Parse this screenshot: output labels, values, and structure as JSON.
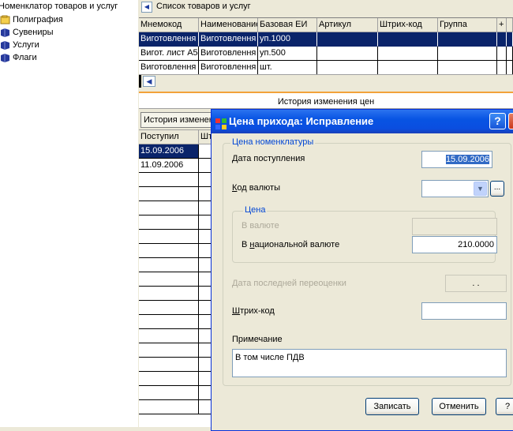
{
  "tree": {
    "root_label": "Номенклатор товаров и услуг",
    "items": [
      {
        "label": "Полиграфия",
        "color": "#d9a21b"
      },
      {
        "label": "Сувениры",
        "color": "#26399b"
      },
      {
        "label": "Услуги",
        "color": "#26399b"
      },
      {
        "label": "Флаги",
        "color": "#26399b"
      }
    ]
  },
  "product_list": {
    "title": "Список товаров и услуг",
    "columns": [
      "Мнемокод",
      "Наименование",
      "Базовая ЕИ",
      "Артикул",
      "Штрих-код",
      "Группа",
      "+"
    ],
    "rows": [
      [
        "Виготовлення",
        "Виготовлення",
        "уп.1000",
        "",
        "",
        "",
        ""
      ],
      [
        "Вигот. лист А5",
        "Виготовлення",
        "уп.500",
        "",
        "",
        "",
        ""
      ],
      [
        "Виготовлення",
        "Виготовлення",
        "шт.",
        "",
        "",
        "",
        ""
      ]
    ]
  },
  "price_history": {
    "title": "История изменения цен",
    "tab_label": "История изменений",
    "columns": [
      "Поступил",
      "Шт"
    ],
    "rows": [
      [
        "15.09.2006",
        ""
      ],
      [
        "11.09.2006",
        ""
      ]
    ]
  },
  "dialog": {
    "title": "Цена прихода: Исправление",
    "help_btn": "?",
    "close_btn": "✕",
    "group_price_title": "Цена номенклатуры",
    "date_label": "Дата поступления",
    "date_value": "15.09.2006",
    "currency_label": "Код валюты",
    "currency_value": "",
    "browse_btn": "...",
    "price_group_title": "Цена",
    "in_currency_label": "В валюте",
    "in_currency_value": "",
    "national_label": "В национальной валюте",
    "national_value": "210.0000",
    "revaluation_label": "Дата последней переоценки",
    "revaluation_value": ". .",
    "barcode_label": "Штрих-код",
    "barcode_value": "",
    "note_label": "Примечание",
    "note_value": "В том числе ПДВ",
    "save_btn": "Записать",
    "cancel_btn": "Отменить",
    "help_footer_btn": "?"
  },
  "colors": {
    "selection": "#0a246a",
    "titlebar": "#0854e3",
    "group_title": "#0046d5"
  }
}
